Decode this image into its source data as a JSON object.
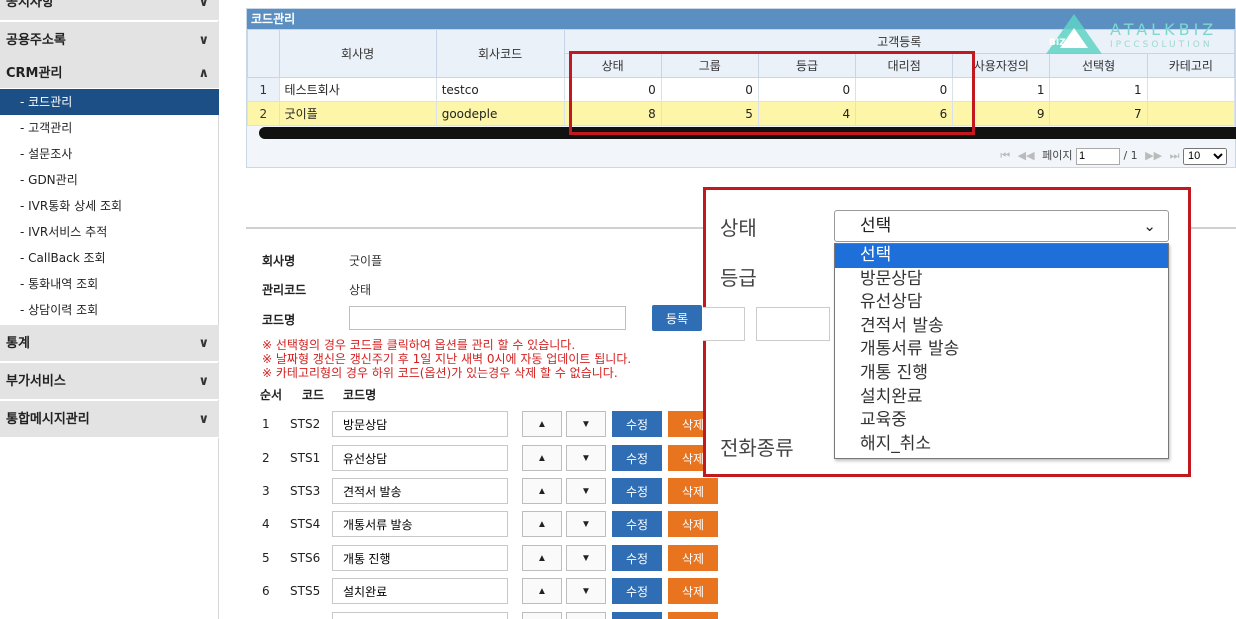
{
  "sidebar": {
    "menus": [
      {
        "label": "공지사항"
      },
      {
        "label": "공용주소록"
      },
      {
        "label": "CRM관리"
      },
      {
        "label": "통계"
      },
      {
        "label": "부가서비스"
      },
      {
        "label": "통합메시지관리"
      }
    ],
    "subitems": [
      {
        "label": "- 코드관리"
      },
      {
        "label": "- 고객관리"
      },
      {
        "label": "- 설문조사"
      },
      {
        "label": "- GDN관리"
      },
      {
        "label": "- IVR통화 상세 조회"
      },
      {
        "label": "- IVR서비스 추적"
      },
      {
        "label": "- CallBack 조회"
      },
      {
        "label": "- 통화내역 조회"
      },
      {
        "label": "- 상담이력 조회"
      }
    ]
  },
  "grid": {
    "title": "코드관리",
    "group_header": "고객등록",
    "columns": [
      "회사명",
      "회사코드",
      "상태",
      "그룹",
      "등급",
      "대리점",
      "사용자정의",
      "선택형",
      "카테고리"
    ],
    "rows": [
      {
        "no": "1",
        "company": "테스트회사",
        "code": "testco",
        "status": "0",
        "group": "0",
        "grade": "0",
        "agency": "0",
        "custom": "1",
        "select": "1",
        "category": ""
      },
      {
        "no": "2",
        "company": "굿이플",
        "code": "goodeple",
        "status": "8",
        "group": "5",
        "grade": "4",
        "agency": "6",
        "custom": "9",
        "select": "7",
        "category": ""
      }
    ],
    "pager": {
      "first": "⏮",
      "prev": "◀◀",
      "page_label": "페이지",
      "page_value": "1",
      "total": "/ 1",
      "next": "▶▶",
      "last": "⏭",
      "page_size": "10"
    }
  },
  "logo": {
    "text": "ATALKBIZ",
    "sub": "IPCCSOLUTION",
    "badge": "BIZ"
  },
  "form": {
    "company_label": "회사명",
    "company_value": "굿이플",
    "mgmt_label": "관리코드",
    "mgmt_value": "상태",
    "codename_label": "코드명",
    "codename_value": "",
    "register_label": "등록",
    "notes": [
      "※ 선택형의 경우 코드를 클릭하여 옵션를 관리 할 수 있습니다.",
      "※ 날짜형 갱신은 갱신주기 후 1일 지난 새벽 0시에 자동 업데이트 됩니다.",
      "※ 카테고리형의 경우 하위 코드(옵션)가 있는경우 삭제 할 수 없습니다."
    ],
    "list_headers": {
      "order": "순서",
      "code": "코드",
      "name": "코드명"
    },
    "up_label": "▲",
    "down_label": "▼",
    "edit_label": "수정",
    "delete_label": "삭제",
    "codes": [
      {
        "order": "1",
        "code": "STS2",
        "name": "방문상담"
      },
      {
        "order": "2",
        "code": "STS1",
        "name": "유선상담"
      },
      {
        "order": "3",
        "code": "STS3",
        "name": "견적서 발송"
      },
      {
        "order": "4",
        "code": "STS4",
        "name": "개통서류 발송"
      },
      {
        "order": "5",
        "code": "STS6",
        "name": "개통 진행"
      },
      {
        "order": "6",
        "code": "STS5",
        "name": "설치완료"
      }
    ]
  },
  "zoom": {
    "status_label": "상태",
    "grade_label": "등급",
    "phone_label": "전화종류",
    "selected": "선택",
    "arrow": "⌄",
    "options": [
      "선택",
      "방문상담",
      "유선상담",
      "견적서 발송",
      "개통서류 발송",
      "개통 진행",
      "설치완료",
      "교육중",
      "해지_취소"
    ]
  },
  "colors": {
    "active": "#1b4f86",
    "highlight": "#1e6fd9",
    "edit": "#2f6eb5",
    "delete": "#e8741f",
    "callout": "#c2181f",
    "selected_row": "#fdf6a9"
  }
}
